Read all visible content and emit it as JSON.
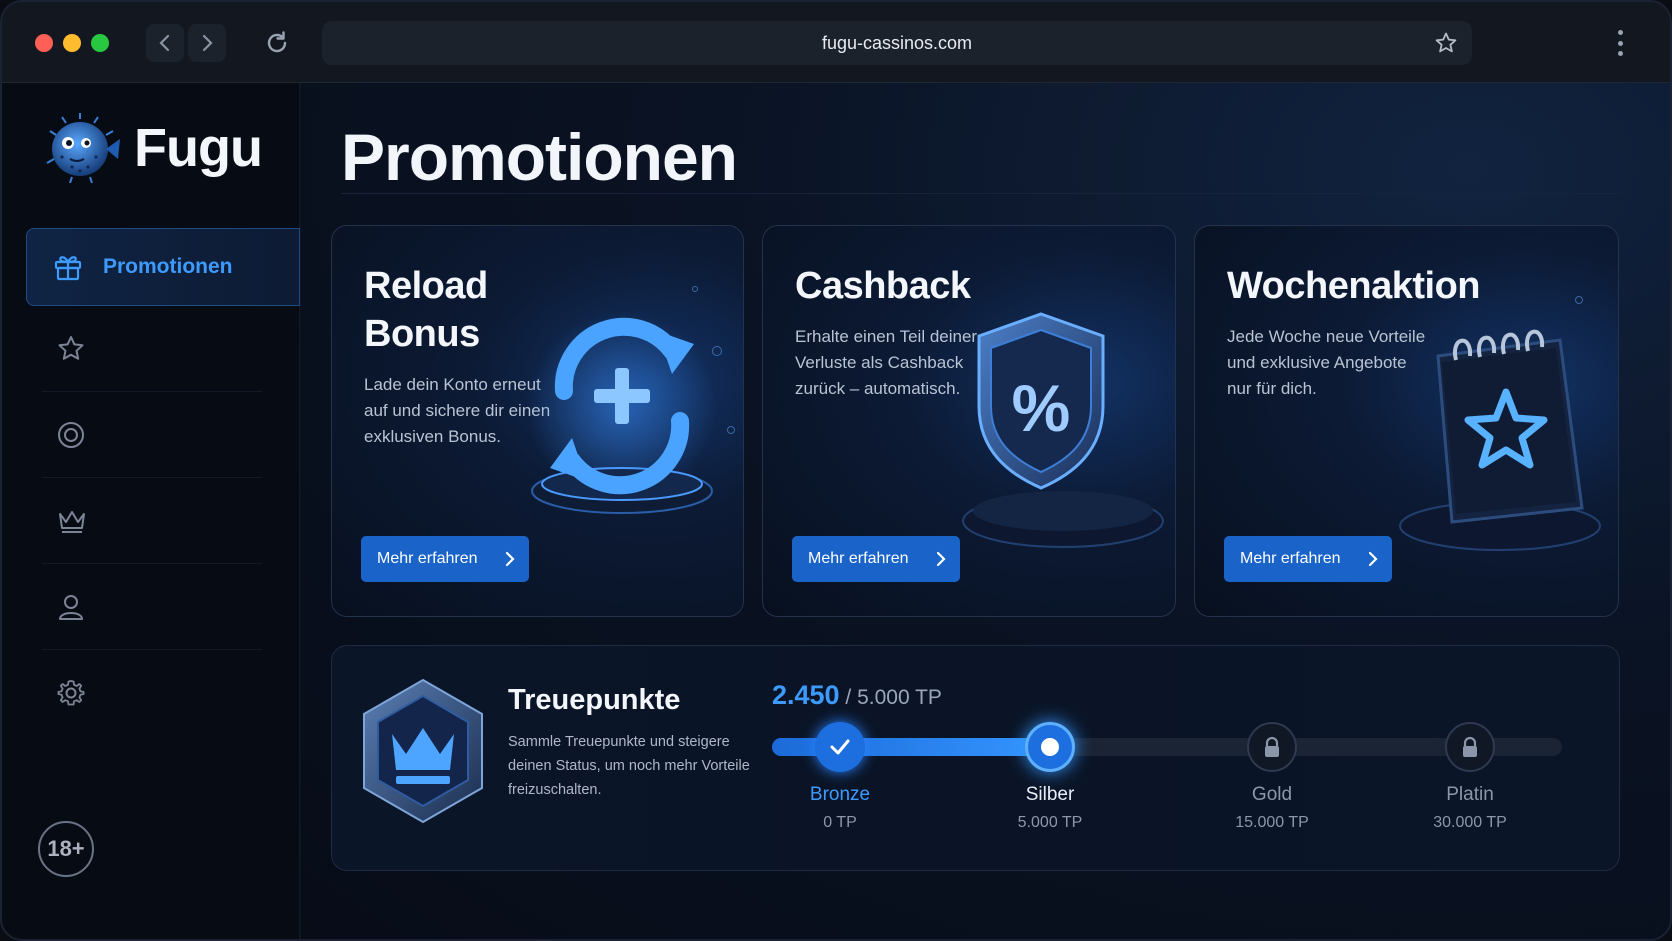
{
  "browser": {
    "url": "fugu-cassinos.com",
    "back_icon": "chevron-left",
    "forward_icon": "chevron-right"
  },
  "sidebar": {
    "brand": "Fugu",
    "active_item": {
      "label": "Promotionen",
      "icon": "gift-icon"
    },
    "items": [
      {
        "icon": "star-icon"
      },
      {
        "icon": "target-icon"
      },
      {
        "icon": "crown-icon"
      },
      {
        "icon": "user-icon"
      },
      {
        "icon": "gear-icon"
      }
    ],
    "age_badge": "18+"
  },
  "page": {
    "title": "Promotionen"
  },
  "cards": [
    {
      "title_line1": "Reload",
      "title_line2": "Bonus",
      "description": "Lade dein Konto erneut auf und sichere dir einen exklusiven Bonus.",
      "button": "Mehr erfahren",
      "art": "reload-plus-icon"
    },
    {
      "title_line1": "Cashback",
      "description": "Erhalte einen Teil deiner Verluste als Cashback zurück – automatisch.",
      "button": "Mehr erfahren",
      "art": "shield-percent-icon"
    },
    {
      "title_line1": "Wochenaktion",
      "description": "Jede Woche neue Vorteile und exklusive Angebote nur für dich.",
      "button": "Mehr erfahren",
      "art": "calendar-star-icon"
    }
  ],
  "loyalty": {
    "title": "Treuepunkte",
    "description": "Sammle Treuepunkte und steigere deinen Status, um noch mehr Vorteile freizuschalten.",
    "current": "2.450",
    "target": "/ 5.000 TP",
    "progress_fraction": 0.355,
    "tiers": [
      {
        "name": "Bronze",
        "points": "0 TP",
        "state": "done"
      },
      {
        "name": "Silber",
        "points": "5.000 TP",
        "state": "current"
      },
      {
        "name": "Gold",
        "points": "15.000 TP",
        "state": "locked"
      },
      {
        "name": "Platin",
        "points": "30.000 TP",
        "state": "locked"
      }
    ]
  },
  "colors": {
    "accent": "#3d9bff",
    "button": "#1a63c9",
    "background": "#0b1220"
  }
}
